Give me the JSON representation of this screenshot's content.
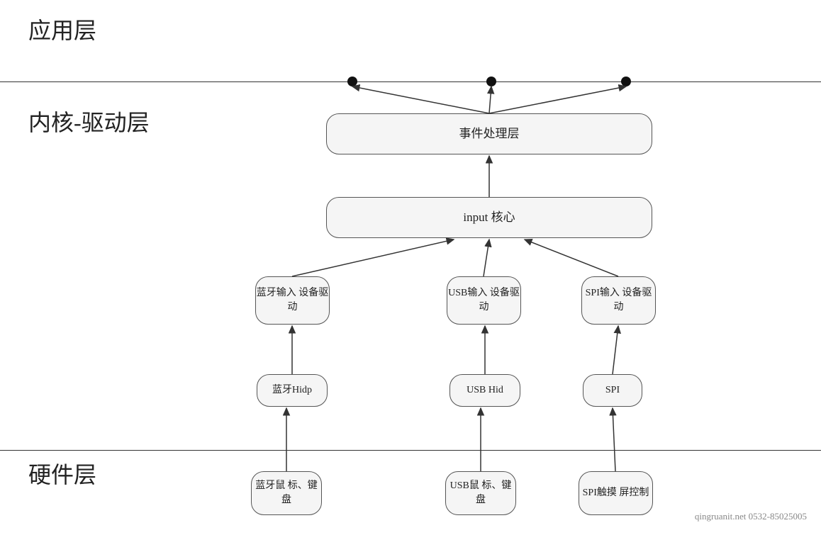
{
  "layers": {
    "app_layer": "应用层",
    "kernel_layer": "内核-驱动层",
    "hardware_layer": "硬件层"
  },
  "boxes": {
    "event_handler": "事件处理层",
    "input_core": "input 核心",
    "bt_driver": "蓝牙输入\n设备驱动",
    "usb_driver": "USB输入\n设备驱动",
    "spi_driver": "SPI输入\n设备驱动",
    "bt_hidp": "蓝牙Hidp",
    "usb_hid": "USB Hid",
    "spi": "SPI",
    "bt_hw": "蓝牙鼠\n标、键盘",
    "usb_hw": "USB鼠\n标、键盘",
    "spi_hw": "SPI触摸\n屏控制"
  },
  "watermark": "qingruanit.net 0532-85025005"
}
